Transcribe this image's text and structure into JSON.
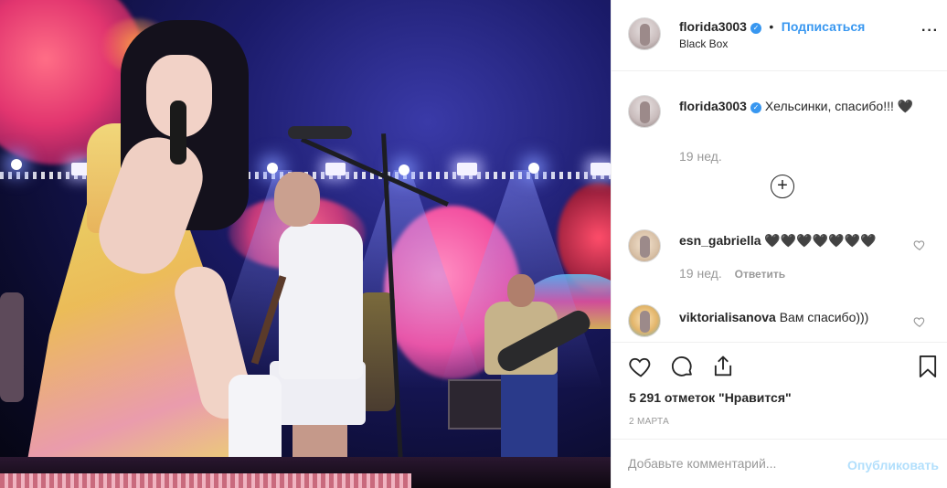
{
  "post": {
    "author": "florida3003",
    "location": "Black Box",
    "follow_label": "Подписаться",
    "separator": "•",
    "more_label": "···"
  },
  "caption": {
    "username": "florida3003",
    "text": "Хельсинки, спасибо!!! 🖤",
    "time": "19 нед.",
    "load_more_label": "+"
  },
  "comments": [
    {
      "username": "esn_gabriella",
      "text": "🖤🖤🖤🖤🖤🖤🖤",
      "time": "19 нед.",
      "reply_label": "Ответить"
    },
    {
      "username": "viktorialisanova",
      "text": "Вам спасибо)))"
    }
  ],
  "actions": {
    "likes_text": "5 291 отметок \"Нравится\"",
    "date": "2 МАРТА"
  },
  "add_comment": {
    "placeholder": "Добавьте комментарий...",
    "publish_label": "Опубликовать"
  },
  "colors": {
    "accent": "#3897f0",
    "muted": "#999999",
    "publish_disabled": "#b2dffc"
  }
}
